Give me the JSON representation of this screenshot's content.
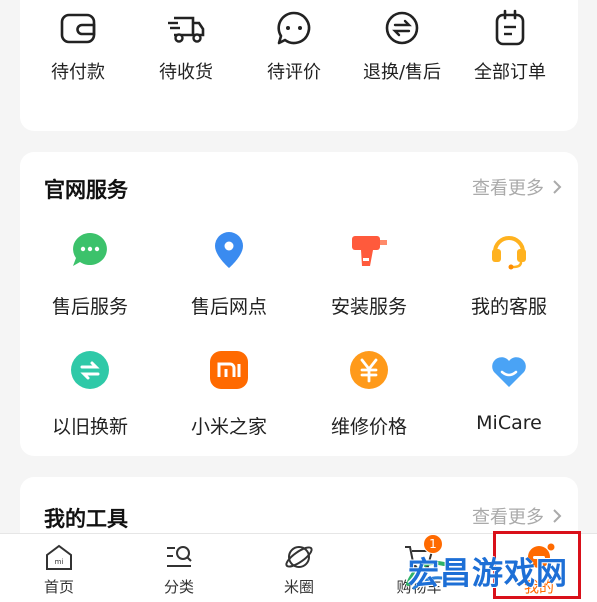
{
  "orders": [
    {
      "label": "待付款",
      "icon": "wallet-icon"
    },
    {
      "label": "待收货",
      "icon": "delivery-truck-icon"
    },
    {
      "label": "待评价",
      "icon": "comment-icon"
    },
    {
      "label": "退换/售后",
      "icon": "exchange-icon"
    },
    {
      "label": "全部订单",
      "icon": "order-list-icon"
    }
  ],
  "services": {
    "title": "官网服务",
    "more": "查看更多",
    "items": [
      {
        "label": "售后服务",
        "icon": "chat-bubble-icon",
        "color": "#3cc26b"
      },
      {
        "label": "售后网点",
        "icon": "location-pin-icon",
        "color": "#3a8bf0"
      },
      {
        "label": "安装服务",
        "icon": "drill-icon",
        "color": "#ff5a3c"
      },
      {
        "label": "我的客服",
        "icon": "headset-icon",
        "color": "#ffb21f"
      },
      {
        "label": "以旧换新",
        "icon": "trade-in-icon",
        "color": "#2fc9a8"
      },
      {
        "label": "小米之家",
        "icon": "mi-logo-icon",
        "color": "#ff6a00"
      },
      {
        "label": "维修价格",
        "icon": "yuan-icon",
        "color": "#ff9a1a"
      },
      {
        "label": "MiCare",
        "icon": "heart-icon",
        "color": "#4aa3f5"
      }
    ]
  },
  "tools": {
    "title": "我的工具",
    "more": "查看更多"
  },
  "tabbar": {
    "tabs": [
      {
        "label": "首页",
        "icon": "home-icon"
      },
      {
        "label": "分类",
        "icon": "category-icon"
      },
      {
        "label": "米圈",
        "icon": "planet-icon"
      },
      {
        "label": "购物车",
        "icon": "cart-icon"
      },
      {
        "label": "我的",
        "icon": "profile-icon"
      }
    ],
    "cart_badge": "1"
  },
  "watermark": "宏昌游戏网",
  "accent": "#ff6a00"
}
